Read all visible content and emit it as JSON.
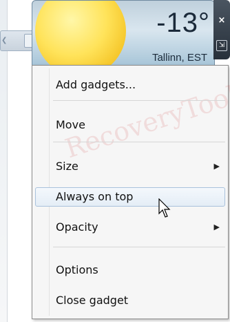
{
  "gadget": {
    "temperature": "-13°",
    "location": "Tallinn, EST"
  },
  "gadget_controls": {
    "close_icon": "close-icon",
    "resize_icon": "resize-icon",
    "close_glyph": "×",
    "resize_glyph": "⇲"
  },
  "watermark": "RecoveryTools",
  "menu": {
    "items": [
      {
        "label": "Add gadgets..."
      },
      {
        "label": "Move"
      },
      {
        "label": "Size",
        "submenu": true
      },
      {
        "label": "Always on top",
        "state": "hover"
      },
      {
        "label": "Opacity",
        "submenu": true
      },
      {
        "label": "Options"
      },
      {
        "label": "Close gadget"
      }
    ],
    "submenu_glyph": "▶"
  },
  "colors": {
    "menu_background": "#f6f6f6",
    "hover_border": "#a9c2dc",
    "sun": "#ffe35a"
  }
}
